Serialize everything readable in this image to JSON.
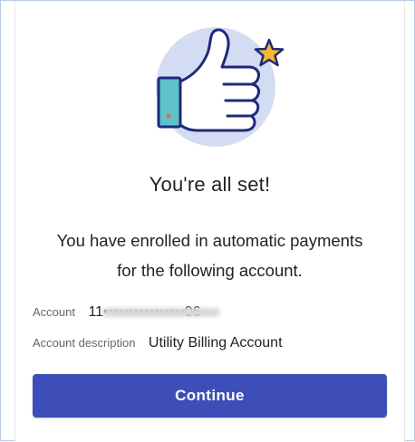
{
  "confirmation": {
    "title": "You're all set!",
    "message": "You have enrolled in automatic payments for the following account.",
    "account_label": "Account",
    "account_value": "11••••••••••••••••06",
    "description_label": "Account description",
    "description_value": "Utility Billing Account",
    "continue_label": "Continue"
  },
  "icons": {
    "hero": "thumbs-up-icon",
    "star": "star-icon"
  },
  "colors": {
    "primary_button": "#3e4eb8",
    "hero_circle": "#d3dcf3",
    "hand_outline": "#1e2a7a",
    "cuff": "#5ec2c9",
    "star": "#f5b82e"
  }
}
